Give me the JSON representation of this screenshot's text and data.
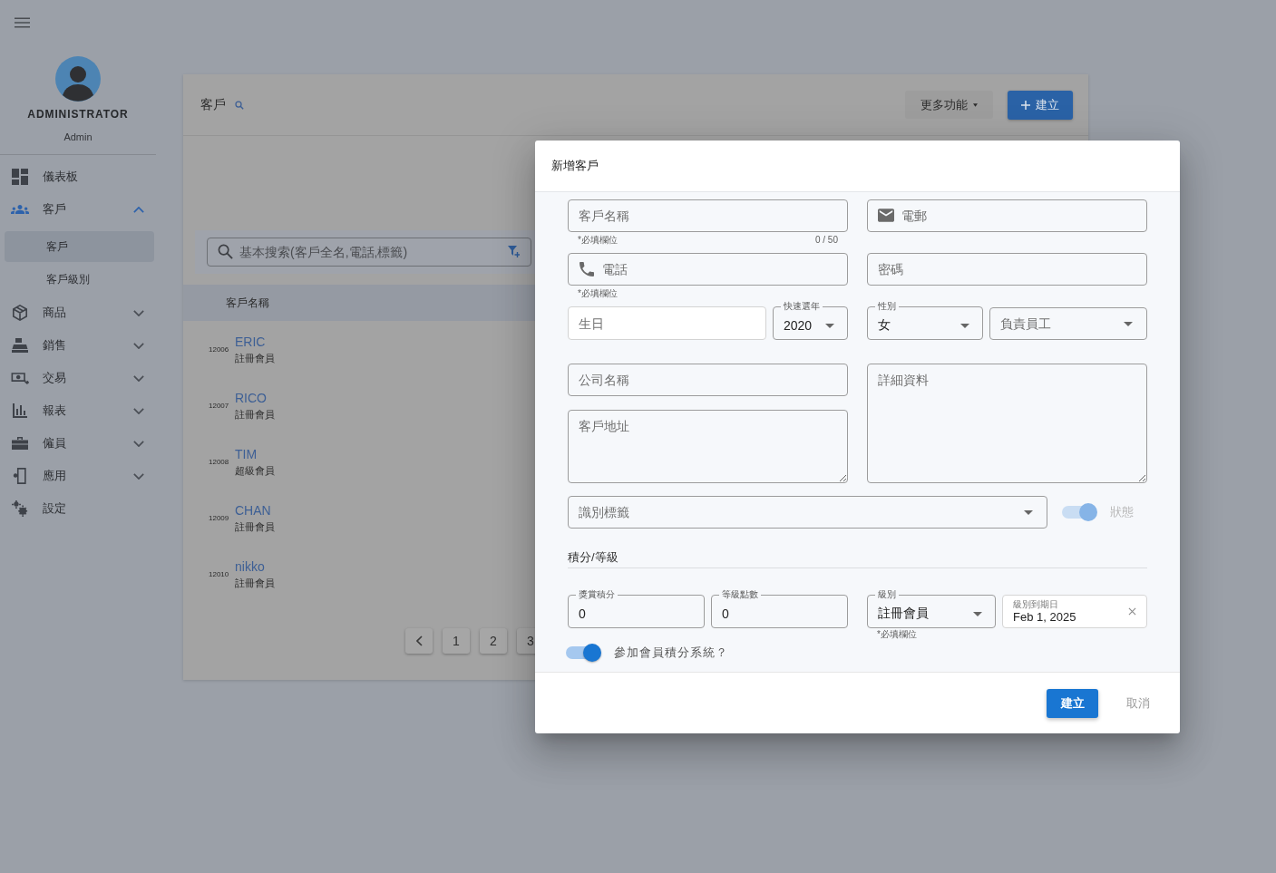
{
  "sidebar": {
    "user": {
      "name": "ADMINISTRATOR",
      "role": "Admin"
    },
    "items": [
      {
        "label": "儀表板",
        "kind": "link",
        "selected": false
      },
      {
        "label": "客戶",
        "kind": "group",
        "selected": true,
        "expanded": true,
        "children": [
          {
            "label": "客戶",
            "selected": true
          },
          {
            "label": "客戶級別",
            "selected": false
          }
        ]
      },
      {
        "label": "商品",
        "kind": "group",
        "selected": false,
        "expanded": false
      },
      {
        "label": "銷售",
        "kind": "group",
        "selected": false,
        "expanded": false
      },
      {
        "label": "交易",
        "kind": "group",
        "selected": false,
        "expanded": false
      },
      {
        "label": "報表",
        "kind": "group",
        "selected": false,
        "expanded": false
      },
      {
        "label": "僱員",
        "kind": "group",
        "selected": false,
        "expanded": false
      },
      {
        "label": "應用",
        "kind": "group",
        "selected": false,
        "expanded": false
      },
      {
        "label": "設定",
        "kind": "link",
        "selected": false
      }
    ]
  },
  "page": {
    "title": "客戶",
    "actions": [
      {
        "label": "更多功能",
        "kind": "menu"
      },
      {
        "label": "建立",
        "kind": "primary"
      }
    ],
    "search": {
      "placeholder": "基本搜索(客戶全名,電話,標籤)"
    },
    "table": {
      "columns": [
        "客戶名稱"
      ],
      "rows": [
        {
          "id": "12006",
          "name": "ERIC",
          "level": "註冊會員"
        },
        {
          "id": "12007",
          "name": "RICO",
          "level": "註冊會員"
        },
        {
          "id": "12008",
          "name": "TIM",
          "level": "超級會員"
        },
        {
          "id": "12009",
          "name": "CHAN",
          "level": "註冊會員"
        },
        {
          "id": "12010",
          "name": "nikko",
          "level": "註冊會員"
        }
      ]
    },
    "pagination": [
      "1",
      "2",
      "3"
    ]
  },
  "dialog": {
    "title": "新增客戶",
    "customer_name": {
      "placeholder": "客戶名稱",
      "hint": "*必填欄位",
      "counter": "0 / 50"
    },
    "email": {
      "placeholder": "電郵"
    },
    "phone": {
      "placeholder": "電話",
      "hint": "*必填欄位"
    },
    "password": {
      "placeholder": "密碼"
    },
    "birthday": {
      "placeholder": "生日"
    },
    "quick_year": {
      "label": "快速選年",
      "value": "2020"
    },
    "gender": {
      "label": "性別",
      "value": "女"
    },
    "staff": {
      "placeholder": "負責員工"
    },
    "company": {
      "placeholder": "公司名稱"
    },
    "address": {
      "placeholder": "客戶地址"
    },
    "details": {
      "placeholder": "詳細資料"
    },
    "tags": {
      "placeholder": "識別標籤"
    },
    "status": {
      "label": "狀態",
      "on": true,
      "disabled": true
    },
    "section": {
      "title": "積分/等級"
    },
    "reward_points": {
      "label": "獎賞積分",
      "value": "0"
    },
    "level_points": {
      "label": "等級點數",
      "value": "0"
    },
    "level": {
      "label": "級別",
      "value": "註冊會員",
      "hint": "*必填欄位"
    },
    "level_expiry": {
      "label": "級別到期日",
      "value": "Feb 1, 2025"
    },
    "join_points": {
      "label": "參加會員積分系統？",
      "on": true,
      "disabled": false
    },
    "buttons": [
      {
        "label": "建立",
        "kind": "primary"
      },
      {
        "label": "取消",
        "kind": "text"
      }
    ]
  }
}
